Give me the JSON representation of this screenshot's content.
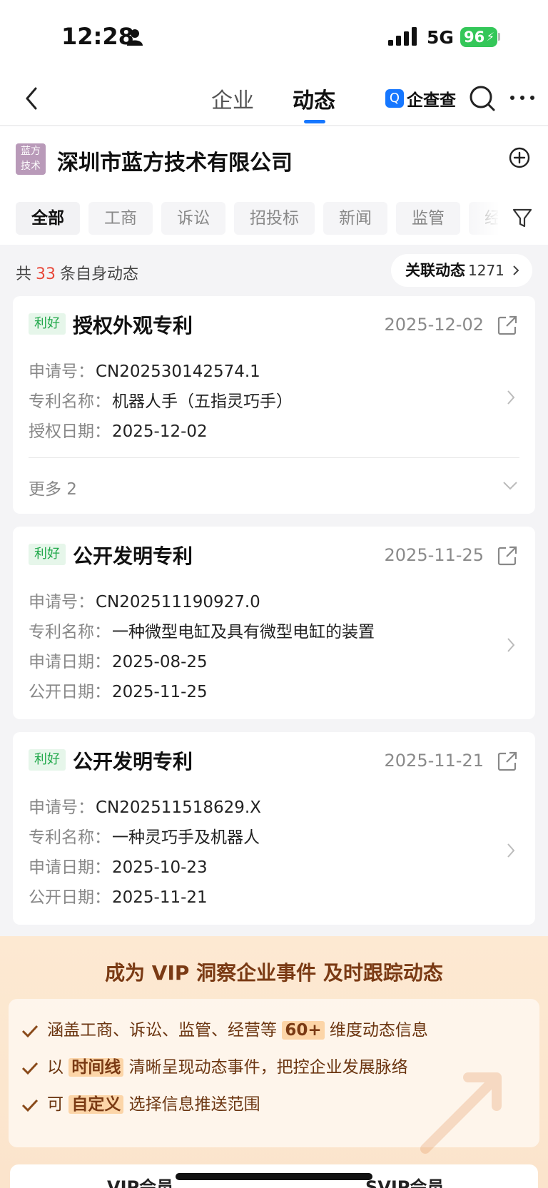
{
  "status": {
    "time": "12:28",
    "network": "5G",
    "battery": "96"
  },
  "nav": {
    "tabs": [
      "企业",
      "动态"
    ],
    "active_tab": "动态",
    "brand": "企查查",
    "brand_logo": "Q"
  },
  "company": {
    "logo_text": [
      "蓝方",
      "技术"
    ],
    "name": "深圳市蓝方技术有限公司",
    "filters": [
      "全部",
      "工商",
      "诉讼",
      "招投标",
      "新闻",
      "监管",
      "经营"
    ],
    "active_filter": "全部"
  },
  "summary": {
    "prefix": "共",
    "count": "33",
    "suffix": "条自身动态",
    "related_label": "关联动态",
    "related_count": "1271"
  },
  "cards": [
    {
      "tag": "利好",
      "title": "授权外观专利",
      "date": "2025-12-02",
      "rows": [
        {
          "label": "申请号：",
          "value": "CN202530142574.1"
        },
        {
          "label": "专利名称：",
          "value": "机器人手（五指灵巧手）"
        },
        {
          "label": "授权日期：",
          "value": "2025-12-02"
        }
      ],
      "more": "更多 2"
    },
    {
      "tag": "利好",
      "title": "公开发明专利",
      "date": "2025-11-25",
      "rows": [
        {
          "label": "申请号：",
          "value": "CN202511190927.0"
        },
        {
          "label": "专利名称：",
          "value": "一种微型电缸及具有微型电缸的装置"
        },
        {
          "label": "申请日期：",
          "value": "2025-08-25"
        },
        {
          "label": "公开日期：",
          "value": "2025-11-25"
        }
      ]
    },
    {
      "tag": "利好",
      "title": "公开发明专利",
      "date": "2025-11-21",
      "rows": [
        {
          "label": "申请号：",
          "value": "CN202511518629.X"
        },
        {
          "label": "专利名称：",
          "value": "一种灵巧手及机器人"
        },
        {
          "label": "申请日期：",
          "value": "2025-10-23"
        },
        {
          "label": "公开日期：",
          "value": "2025-11-21"
        }
      ]
    }
  ],
  "vip": {
    "headline": "成为 VIP 洞察企业事件 及时跟踪动态",
    "items": [
      {
        "pre": "涵盖工商、诉讼、监管、经营等",
        "hl": "60+",
        "post": "维度动态信息"
      },
      {
        "pre": "以",
        "hl": "时间线",
        "post": "清晰呈现动态事件，把控企业发展脉络"
      },
      {
        "pre": "可",
        "hl": "自定义",
        "post": "选择信息推送范围"
      }
    ],
    "plans": [
      "VIP会员",
      "SVIP会员"
    ]
  },
  "colors": {
    "accent": "#1677ff",
    "positive_tag": "#20a84a",
    "count_red": "#e84a3c",
    "vip_text": "#7a3a14"
  }
}
